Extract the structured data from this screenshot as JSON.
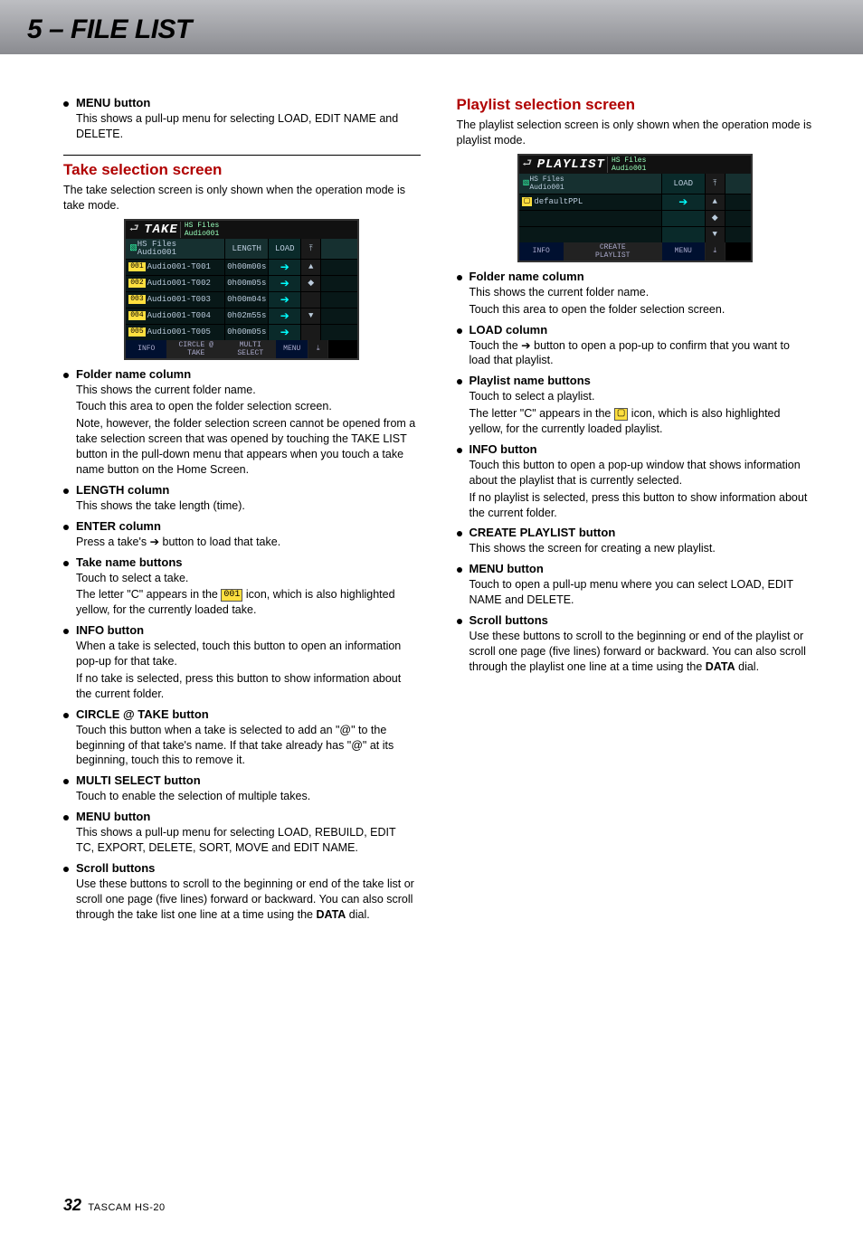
{
  "header": {
    "title": "5 – FILE LIST"
  },
  "footer": {
    "page": "32",
    "model": "TASCAM HS-20"
  },
  "left": {
    "menu_button": {
      "title": "MENU button",
      "body": "This shows a pull-up menu for selecting LOAD, EDIT NAME and DELETE."
    },
    "section_title": "Take selection screen",
    "intro": "The take selection screen is only shown when the operation mode is take mode.",
    "device": {
      "title": "TAKE",
      "path_top": "HS Files",
      "path_bottom": "Audio001",
      "cols": {
        "name": "",
        "length": "LENGTH",
        "load": "LOAD"
      },
      "rows": [
        {
          "badge": "001",
          "name": "Audio001-T001",
          "len": "0h00m00s"
        },
        {
          "badge": "002",
          "name": "Audio001-T002",
          "len": "0h00m05s"
        },
        {
          "badge": "003",
          "name": "Audio001-T003",
          "len": "0h00m04s"
        },
        {
          "badge": "004",
          "name": "Audio001-T004",
          "len": "0h02m55s"
        },
        {
          "badge": "005",
          "name": "Audio001-T005",
          "len": "0h00m05s"
        }
      ],
      "footer": {
        "info": "INFO",
        "circle": "CIRCLE @\nTAKE",
        "multi": "MULTI\nSELECT",
        "menu": "MENU"
      }
    },
    "items": [
      {
        "title": "Folder name column",
        "paras": [
          "This shows the current folder name.",
          "Touch this area to open the folder selection screen.",
          "Note, however, the folder selection screen cannot be opened from a take selection screen that was opened by touching the TAKE LIST button in the pull-down menu that appears when you touch a take name button on the Home Screen."
        ]
      },
      {
        "title": "LENGTH column",
        "paras": [
          "This shows the take length (time)."
        ]
      },
      {
        "title": "ENTER column",
        "paras": [
          "Press a take's ➔ button to load that take."
        ]
      },
      {
        "title": "Take name buttons",
        "paras": [
          "Touch to select a take.",
          "The letter \"C\" appears in the |ICON001| icon, which is also highlighted yellow, for the currently loaded take."
        ],
        "icon_text": "001"
      },
      {
        "title": "INFO button",
        "paras": [
          "When a take is selected, touch this button to open an information pop-up for that take.",
          "If no take is selected, press this button to show information about the current folder."
        ]
      },
      {
        "title": "CIRCLE @ TAKE button",
        "paras": [
          "Touch this button when a take is selected to add an \"@\" to the beginning of that take's name. If that take already has \"@\" at its beginning, touch this to remove it."
        ]
      },
      {
        "title": "MULTI SELECT button",
        "paras": [
          "Touch to enable the selection of multiple takes."
        ]
      },
      {
        "title": "MENU button",
        "paras": [
          "This shows a pull-up menu for selecting LOAD, REBUILD, EDIT TC, EXPORT, DELETE, SORT, MOVE and EDIT NAME."
        ]
      },
      {
        "title": "Scroll buttons",
        "paras": [
          "Use these buttons to scroll to the beginning or end of the take list or scroll one page (five lines) forward or backward. You can also scroll through the take list one line at a time using the DATA dial."
        ],
        "bold_word": "DATA"
      }
    ]
  },
  "right": {
    "section_title": "Playlist selection screen",
    "intro": "The playlist selection screen is only shown when the operation mode is playlist mode.",
    "device": {
      "title": "PLAYLIST",
      "path_top": "HS Files",
      "path_bottom": "Audio001",
      "breadcrumb_top": "HS Files",
      "breadcrumb_bottom": "Audio001",
      "load": "LOAD",
      "row_name": "defaultPPL",
      "footer": {
        "info": "INFO",
        "create": "CREATE\nPLAYLIST",
        "menu": "MENU"
      }
    },
    "items": [
      {
        "title": "Folder name column",
        "paras": [
          "This shows the current folder name.",
          "Touch this area to open the folder selection screen."
        ]
      },
      {
        "title": "LOAD column",
        "paras": [
          "Touch the ➔ button to open a pop-up to confirm that you want to load that playlist."
        ]
      },
      {
        "title": "Playlist name buttons",
        "paras": [
          "Touch to select a playlist.",
          "The letter \"C\" appears in the |ICONF| icon, which is also highlighted yellow, for the currently loaded playlist."
        ],
        "icon_text": "▢"
      },
      {
        "title": "INFO button",
        "paras": [
          "Touch this button to open a pop-up window that shows information about the playlist that is currently selected.",
          "If no playlist is selected, press this button to show information about the current folder."
        ]
      },
      {
        "title": "CREATE PLAYLIST button",
        "paras": [
          "This shows the screen for creating a new playlist."
        ]
      },
      {
        "title": "MENU button",
        "paras": [
          "Touch to open a pull-up menu where you can select LOAD, EDIT NAME and DELETE."
        ]
      },
      {
        "title": "Scroll buttons",
        "paras": [
          "Use these buttons to scroll to the beginning or end of the playlist or scroll one page (five lines) forward or backward. You can also scroll through the playlist one line at a time using the DATA dial."
        ],
        "bold_word": "DATA"
      }
    ]
  }
}
